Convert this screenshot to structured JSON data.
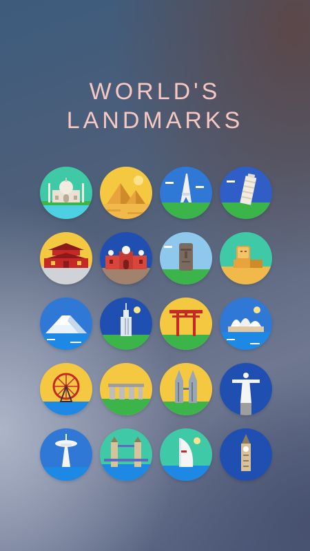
{
  "title": {
    "line1": "WORLD'S",
    "line2": "LANDMARKS"
  },
  "icons": [
    {
      "name": "taj-mahal-icon",
      "bg": "#3fc9a6"
    },
    {
      "name": "pyramids-icon",
      "bg": "#f5c842"
    },
    {
      "name": "eiffel-tower-icon",
      "bg": "#2f78d6"
    },
    {
      "name": "leaning-tower-pisa-icon",
      "bg": "#2f5fc6"
    },
    {
      "name": "forbidden-city-icon",
      "bg": "#f5c842"
    },
    {
      "name": "red-fort-icon",
      "bg": "#1f4fb0"
    },
    {
      "name": "moai-icon",
      "bg": "#8ec8ec"
    },
    {
      "name": "sphinx-icon",
      "bg": "#3fc9a6"
    },
    {
      "name": "mount-fuji-icon",
      "bg": "#2f78d6"
    },
    {
      "name": "empire-state-building-icon",
      "bg": "#1f4fb0"
    },
    {
      "name": "torii-gate-icon",
      "bg": "#f5c842"
    },
    {
      "name": "sydney-opera-house-icon",
      "bg": "#2f78d6"
    },
    {
      "name": "ferris-wheel-icon",
      "bg": "#f5c842"
    },
    {
      "name": "stonehenge-icon",
      "bg": "#f5c842"
    },
    {
      "name": "petronas-towers-icon",
      "bg": "#f5c842"
    },
    {
      "name": "christ-the-redeemer-icon",
      "bg": "#1f4fb0"
    },
    {
      "name": "space-needle-icon",
      "bg": "#2f78d6"
    },
    {
      "name": "tower-bridge-icon",
      "bg": "#3fc9a6"
    },
    {
      "name": "burj-al-arab-icon",
      "bg": "#3fc9a6"
    },
    {
      "name": "big-ben-icon",
      "bg": "#1f4fb0"
    }
  ]
}
